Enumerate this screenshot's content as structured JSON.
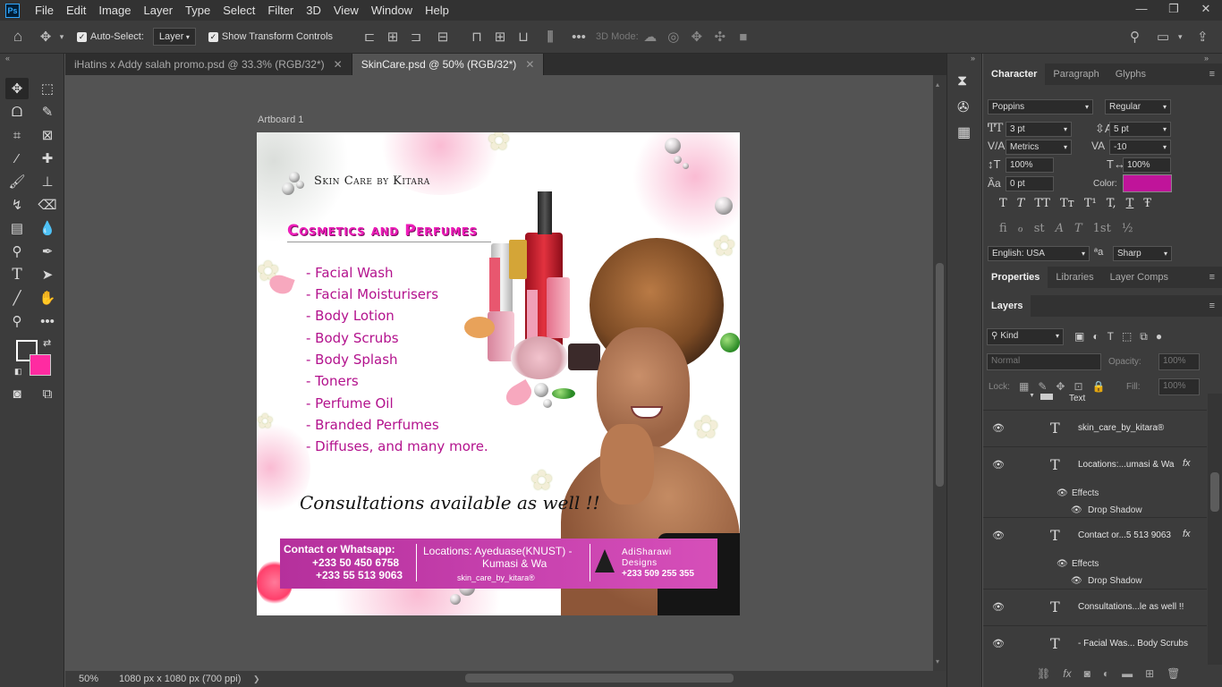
{
  "app": {
    "logo": "Ps"
  },
  "menu": [
    "File",
    "Edit",
    "Image",
    "Layer",
    "Type",
    "Select",
    "Filter",
    "3D",
    "View",
    "Window",
    "Help"
  ],
  "window_controls": [
    "—",
    "❐",
    "✕"
  ],
  "options_bar": {
    "auto_select_label": "Auto-Select:",
    "auto_select_value": "Layer",
    "show_transform_label": "Show Transform Controls",
    "mode_3d_label": "3D Mode:"
  },
  "doc_tabs": [
    {
      "label": "iHatins x Addy salah promo.psd @ 33.3% (RGB/32*)",
      "close": "✕"
    },
    {
      "label": "SkinCare.psd @ 50% (RGB/32*)",
      "close": "✕"
    }
  ],
  "artboard_label": "Artboard 1",
  "artwork": {
    "brand": "Skin Care by Kitara",
    "heading": "Cosmetics and Perfumes",
    "items": [
      "- Facial Wash",
      "- Facial Moisturisers",
      "- Body Lotion",
      "- Body Scrubs",
      "- Body Splash",
      "- Toners",
      "- Perfume Oil",
      "- Branded Perfumes",
      "- Diffuses, and many more."
    ],
    "consult": "Consultations available as well !!",
    "contact_title": "Contact or Whatsapp:",
    "phone1": "+233 50 450 6758",
    "phone2": "+233 55 513 9063",
    "locations_line1": "Locations: Ayeduase(KNUST) -",
    "locations_line2": "Kumasi & Wa",
    "handle": "skin_care_by_kitara®",
    "designer1": "AdiSharawi",
    "designer2": "Designs",
    "designer_phone": "+233 509 255 355"
  },
  "status": {
    "zoom": "50%",
    "doc_info": "1080 px x 1080 px (700 ppi)",
    "arrow": "❯"
  },
  "character_panel": {
    "tabs": [
      "Character",
      "Paragraph",
      "Glyphs"
    ],
    "font_family": "Poppins",
    "font_style": "Regular",
    "font_size": "3 pt",
    "leading": "5 pt",
    "kerning": "Metrics",
    "tracking": "-10",
    "vertical_scale": "100%",
    "horizontal_scale": "100%",
    "baseline_shift": "0 pt",
    "color_label": "Color:",
    "color_value": "#c0149a",
    "style_buttons": [
      "T",
      "T",
      "TT",
      "Tт",
      "T¹",
      "T,",
      "T",
      "Ŧ"
    ],
    "opentype_buttons": [
      "fi",
      "ℴ",
      "st",
      "A",
      "T",
      "1st",
      "½"
    ],
    "language": "English: USA",
    "aa_label": "ªa",
    "antialias": "Sharp"
  },
  "properties_tabs": [
    "Properties",
    "Libraries",
    "Layer Comps"
  ],
  "layers_panel": {
    "tab": "Layers",
    "filter_kind": "Kind",
    "blend_mode": "Normal",
    "opacity_label": "Opacity:",
    "opacity": "100%",
    "lock_label": "Lock:",
    "fill_label": "Fill:",
    "fill": "100%",
    "group_name": "Text",
    "effects_label": "Effects",
    "drop_shadow_label": "Drop Shadow",
    "fx": "fx",
    "layers": [
      {
        "name": "skin_care_by_kitara®"
      },
      {
        "name": "Locations:...umasi & Wa"
      },
      {
        "name": "Contact or...5 513 9063"
      },
      {
        "name": "Consultations...le as well !!"
      },
      {
        "name": "- Facial Was... Body Scrubs"
      }
    ]
  }
}
